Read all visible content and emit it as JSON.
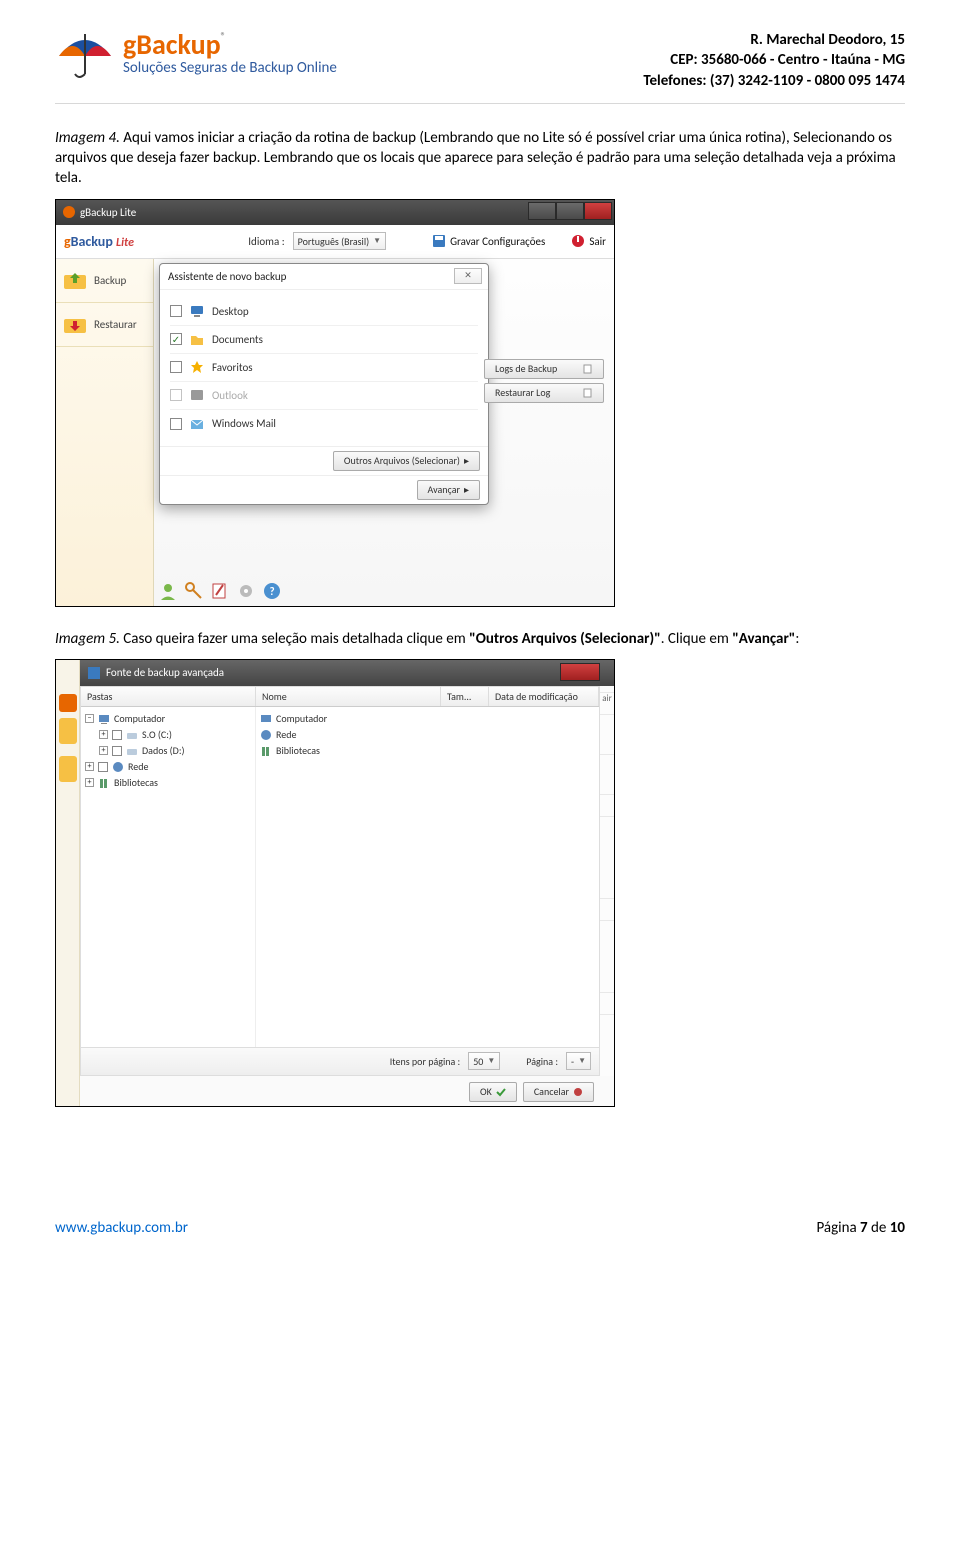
{
  "header": {
    "brand": "gBackup",
    "tagline": "Soluções Seguras de Backup Online",
    "address_line1": "R. Marechal Deodoro, 15",
    "address_line2": "CEP: 35680-066 - Centro - Itaúna - MG",
    "address_line3": "Telefones: (37) 3242-1109 - 0800 095 1474"
  },
  "para1": {
    "lead": "Imagem 4.",
    "rest": " Aqui vamos iniciar a criação da rotina de backup (Lembrando que no Lite só é possível criar uma única rotina), Selecionando os arquivos que deseja fazer backup. Lembrando que os locais que aparece para seleção é padrão para uma seleção detalhada veja a próxima tela."
  },
  "shot1": {
    "window_title": "gBackup Lite",
    "toolbar": {
      "idioma_label": "Idioma :",
      "idioma_value": "Português (Brasil)",
      "gravar": "Gravar Configurações",
      "sair": "Sair"
    },
    "sidebar": {
      "backup": "Backup",
      "restaurar": "Restaurar"
    },
    "dialog": {
      "title": "Assistente de novo backup",
      "items": {
        "desktop": "Desktop",
        "documents": "Documents",
        "favoritos": "Favoritos",
        "outlook": "Outlook",
        "windows_mail": "Windows Mail"
      },
      "outros": "Outros Arquivos (Selecionar)",
      "avancar": "Avançar"
    },
    "side_buttons": {
      "logs_backup": "Logs de Backup",
      "restaurar_log": "Restaurar Log"
    }
  },
  "para2": {
    "lead": "Imagem 5.",
    "rest1": " Caso queira fazer uma seleção mais detalhada clique em ",
    "bold1": "\"Outros Arquivos (Selecionar)\"",
    "rest2": ". Clique em ",
    "bold2": "\"Avançar\"",
    "rest3": ":"
  },
  "shot2": {
    "window_title": "Fonte de backup avançada",
    "columns": {
      "pastas": "Pastas",
      "nome": "Nome",
      "tam": "Tam...",
      "data": "Data de modificação"
    },
    "tree_left": {
      "computador": "Computador",
      "so": "S.O (C:)",
      "dados": "Dados (D:)",
      "rede": "Rede",
      "bibliotecas": "Bibliotecas"
    },
    "tree_right": {
      "computador": "Computador",
      "rede": "Rede",
      "bibliotecas": "Bibliotecas"
    },
    "footer": {
      "itens_label": "Itens por página :",
      "itens_value": "50",
      "pagina_label": "Página :",
      "pagina_value": "-",
      "ok": "OK",
      "cancelar": "Cancelar"
    },
    "right_label": "air"
  },
  "footer": {
    "url": "www.gbackup.com.br",
    "page_prefix": "Página ",
    "page_num": "7",
    "page_mid": " de ",
    "page_total": "10"
  }
}
